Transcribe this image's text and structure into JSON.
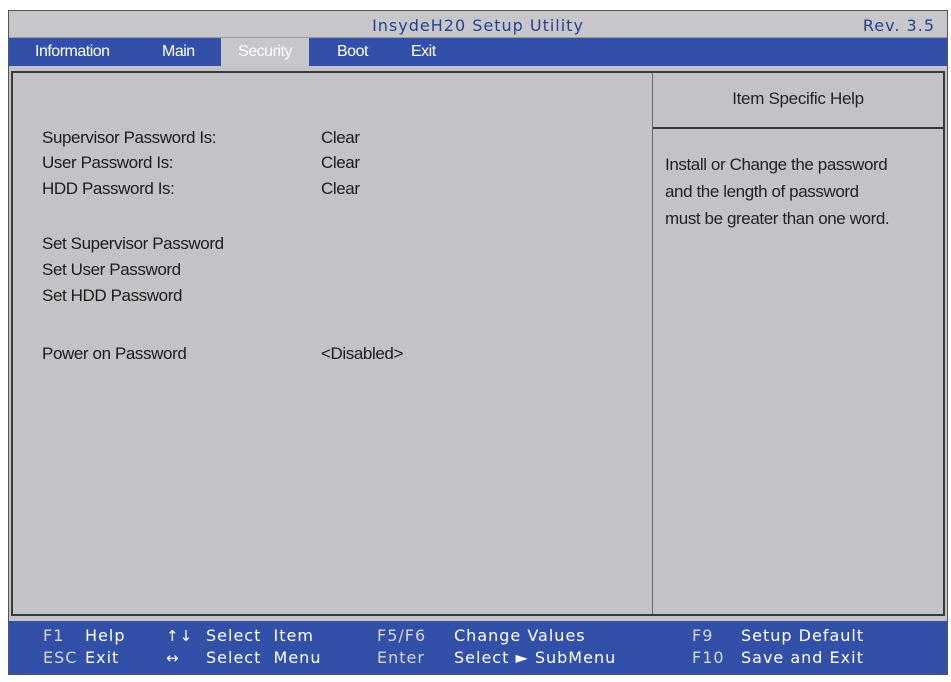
{
  "titlebar": {
    "title": "InsydeH20 Setup Utility",
    "revision": "Rev. 3.5"
  },
  "menu": {
    "items": [
      {
        "label": "Information",
        "active": false
      },
      {
        "label": "Main",
        "active": false
      },
      {
        "label": "Security",
        "active": true
      },
      {
        "label": "Boot",
        "active": false
      },
      {
        "label": "Exit",
        "active": false
      }
    ]
  },
  "security": {
    "status": [
      {
        "label": "Supervisor Password Is:",
        "value": "Clear"
      },
      {
        "label": "User Password Is:",
        "value": "Clear"
      },
      {
        "label": "HDD Password Is:",
        "value": "Clear"
      }
    ],
    "actions": [
      {
        "label": "Set Supervisor Password"
      },
      {
        "label": "Set User Password"
      },
      {
        "label": "Set HDD Password"
      }
    ],
    "power_on": {
      "label": "Power on Password",
      "value": "<Disabled>"
    }
  },
  "help": {
    "title": "Item Specific Help",
    "lines": [
      "Install or Change the password",
      "and the length of password",
      "must be greater than one word."
    ]
  },
  "footer": {
    "row1": {
      "f1_key": "F1",
      "f1_desc": "Help",
      "arrows_key": "↑↓",
      "arrows_desc": "Select  Item",
      "f5f6_key": "F5/F6",
      "f5f6_desc": "Change Values",
      "f9_key": "F9",
      "f9_desc": "Setup Default"
    },
    "row2": {
      "esc_key": "ESC",
      "esc_desc": "Exit",
      "lr_key": "↔",
      "lr_desc": "Select  Menu",
      "enter_key": "Enter",
      "enter_desc": "Select ► SubMenu",
      "f10_key": "F10",
      "f10_desc": "Save and Exit"
    }
  },
  "colors": {
    "menubar": "#3350a8",
    "background": "#c3c3c7",
    "title_text": "#2a3f8f"
  }
}
